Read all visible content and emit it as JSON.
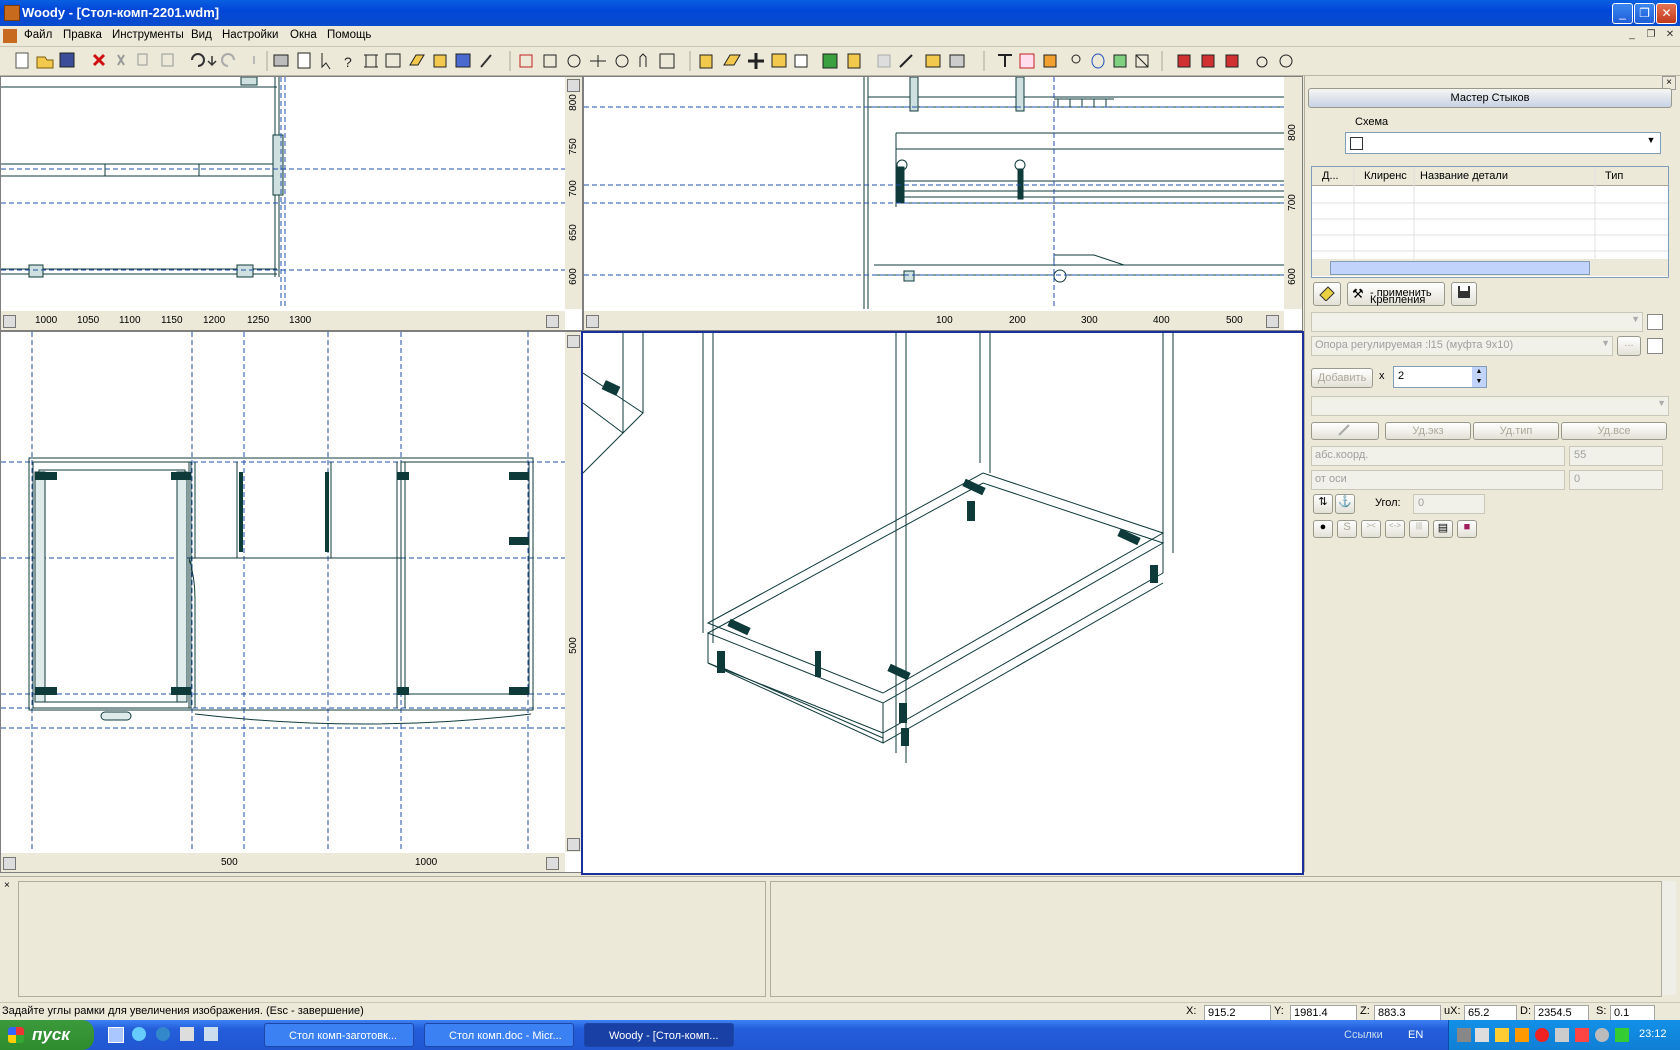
{
  "window": {
    "title": "Woody - [Стол-комп-2201.wdm]",
    "controls": [
      "_",
      "❐",
      "✕"
    ],
    "mdi_controls": [
      "_",
      "❐",
      "✕"
    ]
  },
  "menu": [
    "Файл",
    "Правка",
    "Инструменты",
    "Вид",
    "Настройки",
    "Окна",
    "Помощь"
  ],
  "viewports": {
    "top_left": {
      "h_ticks": [
        "1000",
        "1050",
        "1100",
        "1150",
        "1200",
        "1250",
        "1300"
      ],
      "v_ticks": [
        "800",
        "750",
        "700",
        "650",
        "600"
      ]
    },
    "top_right": {
      "h_ticks": [
        "100",
        "200",
        "300",
        "400",
        "500"
      ],
      "v_ticks": [
        "800",
        "700",
        "600"
      ]
    },
    "bottom_left": {
      "h_ticks": [
        "500",
        "1000"
      ],
      "v_ticks": [
        "500"
      ]
    }
  },
  "panel": {
    "title": "Мастер Стыков",
    "scheme_label": "Схема",
    "table_headers": [
      "Д...",
      "Клиренс",
      "Название детали",
      "Тип"
    ],
    "apply_label": "- применить",
    "fastenings_label": "Крепления",
    "fastening_item": "Опора регулируемая :l15 (муфта 9x10)",
    "add_button": "Добавить",
    "times": "x",
    "quantity": "2",
    "del_inst": "Уд.экз",
    "del_type": "Уд.тип",
    "del_all": "Уд.все",
    "coord_mode": "абс.коорд.",
    "coord_value": "55",
    "axis_mode": "от оси",
    "axis_value": "0",
    "angle_label": "Угол:",
    "angle_value": "0",
    "s_button": "S"
  },
  "status": {
    "hint": "Задайте углы рамки для увеличения изображения. (Esc - завершение)",
    "x_label": "X:",
    "x_value": "915.2",
    "y_label": "Y:",
    "y_value": "1981.4",
    "z_label": "Z:",
    "z_value": "883.3",
    "ux_label": "uX:",
    "ux_value": "65.2",
    "d_label": "D:",
    "d_value": "2354.5",
    "s_label": "S:",
    "s_value": "0.1"
  },
  "taskbar": {
    "start": "пуск",
    "tasks": [
      "Стол комп-заготовк...",
      "Стол комп.doc - Micr...",
      "Woody - [Стол-комп..."
    ],
    "links": "Ссылки",
    "lang": "EN",
    "clock": "23:12"
  },
  "colors": {
    "title_blue": "#0046d8",
    "dash_blue": "#1f4fa8",
    "line_teal": "#0f3a3a",
    "active_border": "#1a2f9a"
  }
}
